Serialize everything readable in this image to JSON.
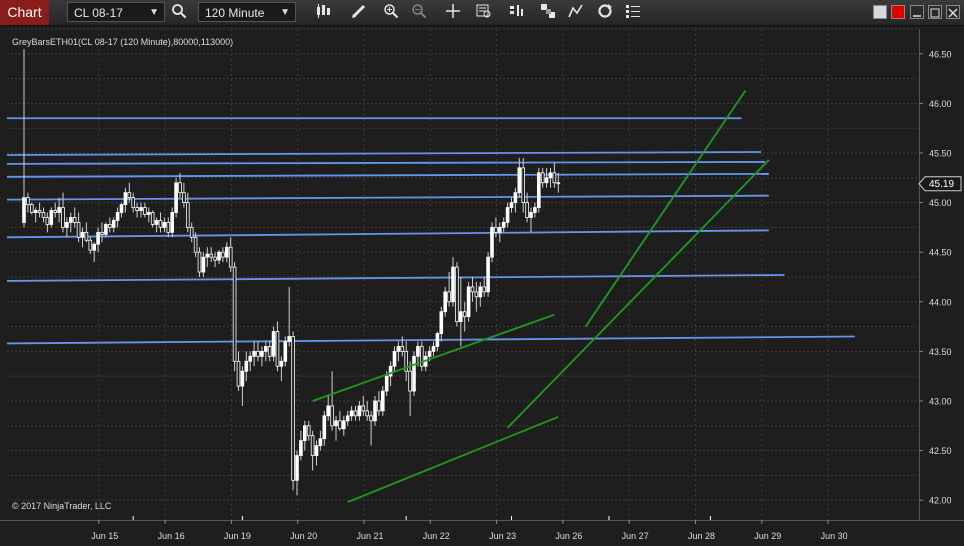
{
  "toolbar": {
    "chart_tab": "Chart",
    "instrument": "CL 08-17",
    "interval": "120 Minute",
    "icons": [
      "search-icon",
      "bar-type-icon",
      "pencil-icon",
      "zoom-in-icon",
      "zoom-out-icon",
      "crosshair-icon",
      "data-box-icon",
      "strategies-icon",
      "indicators-icon",
      "drawing-tools-icon",
      "reload-icon",
      "properties-icon"
    ]
  },
  "chart": {
    "title": "GreyBarsETH01(CL 08-17 (120 Minute),80000,113000)",
    "copyright": "© 2017 NinjaTrader, LLC",
    "last_price": "45.19",
    "colors": {
      "background": "#1e1e1e",
      "grid": "#3c3c3c",
      "candle": "#ffffff",
      "wick": "#cfcfcf",
      "hline": "#6495ed",
      "trendline": "#1e9a1e",
      "marker": "#ffffff"
    }
  },
  "chart_data": {
    "type": "candlestick",
    "title": "GreyBarsETH01(CL 08-17 (120 Minute),80000,113000)",
    "ylim": [
      41.8,
      46.75
    ],
    "yticks": [
      "46.50",
      "46.00",
      "45.50",
      "45.00",
      "44.50",
      "44.00",
      "43.50",
      "43.00",
      "42.50",
      "42.00"
    ],
    "ytick_values": [
      46.5,
      46.0,
      45.5,
      45.0,
      44.5,
      44.0,
      43.5,
      43.0,
      42.5,
      42.0
    ],
    "xticks": [
      "Jun 15",
      "Jun 16",
      "Jun 19",
      "Jun 20",
      "Jun 21",
      "Jun 22",
      "Jun 23",
      "Jun 26",
      "Jun 27",
      "Jun 28",
      "Jun 29",
      "Jun 30"
    ],
    "xtick_index": [
      12,
      29,
      46,
      63,
      80,
      97,
      114,
      131,
      148,
      165,
      182,
      199
    ],
    "candles": [
      [
        44.8,
        46.55,
        44.75,
        45.05
      ],
      [
        45.05,
        45.1,
        44.9,
        44.98
      ],
      [
        44.98,
        45.0,
        44.88,
        44.9
      ],
      [
        44.9,
        44.95,
        44.8,
        44.92
      ],
      [
        44.92,
        45.0,
        44.85,
        44.9
      ],
      [
        44.9,
        44.95,
        44.8,
        44.85
      ],
      [
        44.85,
        44.9,
        44.7,
        44.78
      ],
      [
        44.78,
        44.95,
        44.75,
        44.92
      ],
      [
        44.92,
        45.0,
        44.85,
        44.9
      ],
      [
        44.9,
        45.05,
        44.8,
        44.95
      ],
      [
        44.95,
        45.1,
        44.7,
        44.75
      ],
      [
        44.75,
        44.85,
        44.65,
        44.8
      ],
      [
        44.8,
        44.9,
        44.7,
        44.85
      ],
      [
        44.85,
        44.95,
        44.75,
        44.8
      ],
      [
        44.8,
        44.9,
        44.6,
        44.65
      ],
      [
        44.65,
        44.75,
        44.55,
        44.7
      ],
      [
        44.7,
        44.8,
        44.6,
        44.62
      ],
      [
        44.62,
        44.65,
        44.48,
        44.52
      ],
      [
        44.52,
        44.6,
        44.4,
        44.58
      ],
      [
        44.58,
        44.75,
        44.5,
        44.7
      ],
      [
        44.7,
        44.8,
        44.6,
        44.68
      ],
      [
        44.68,
        44.8,
        44.65,
        44.78
      ],
      [
        44.78,
        44.85,
        44.7,
        44.75
      ],
      [
        44.75,
        44.85,
        44.7,
        44.82
      ],
      [
        44.82,
        44.95,
        44.75,
        44.9
      ],
      [
        44.9,
        45.0,
        44.85,
        44.98
      ],
      [
        44.98,
        45.15,
        44.9,
        45.1
      ],
      [
        45.1,
        45.2,
        45.0,
        45.05
      ],
      [
        45.05,
        45.1,
        44.9,
        44.95
      ],
      [
        44.95,
        45.0,
        44.85,
        44.92
      ],
      [
        44.92,
        45.0,
        44.85,
        44.95
      ],
      [
        44.95,
        45.0,
        44.85,
        44.88
      ],
      [
        44.88,
        44.95,
        44.8,
        44.9
      ],
      [
        44.9,
        44.92,
        44.75,
        44.78
      ],
      [
        44.78,
        44.85,
        44.7,
        44.82
      ],
      [
        44.82,
        44.9,
        44.7,
        44.75
      ],
      [
        44.75,
        44.85,
        44.7,
        44.8
      ],
      [
        44.8,
        44.85,
        44.65,
        44.7
      ],
      [
        44.7,
        44.95,
        44.65,
        44.9
      ],
      [
        44.9,
        45.25,
        44.85,
        45.2
      ],
      [
        45.2,
        45.3,
        45.05,
        45.1
      ],
      [
        45.1,
        45.2,
        44.95,
        45.0
      ],
      [
        45.0,
        45.1,
        44.7,
        44.75
      ],
      [
        44.75,
        44.8,
        44.6,
        44.65
      ],
      [
        44.65,
        44.7,
        44.45,
        44.5
      ],
      [
        44.5,
        44.55,
        44.25,
        44.3
      ],
      [
        44.3,
        44.5,
        44.25,
        44.45
      ],
      [
        44.45,
        44.55,
        44.35,
        44.48
      ],
      [
        44.48,
        44.55,
        44.4,
        44.45
      ],
      [
        44.45,
        44.5,
        44.35,
        44.42
      ],
      [
        44.42,
        44.52,
        44.38,
        44.5
      ],
      [
        44.5,
        44.55,
        44.4,
        44.45
      ],
      [
        44.45,
        44.6,
        44.4,
        44.55
      ],
      [
        44.55,
        44.65,
        44.3,
        44.35
      ],
      [
        44.35,
        44.4,
        43.3,
        43.4
      ],
      [
        43.4,
        43.5,
        43.1,
        43.15
      ],
      [
        43.15,
        43.35,
        42.95,
        43.3
      ],
      [
        43.3,
        43.5,
        43.2,
        43.4
      ],
      [
        43.4,
        43.5,
        43.3,
        43.45
      ],
      [
        43.45,
        43.6,
        43.35,
        43.5
      ],
      [
        43.5,
        43.6,
        43.4,
        43.45
      ],
      [
        43.45,
        43.55,
        43.35,
        43.5
      ],
      [
        43.5,
        43.6,
        43.4,
        43.55
      ],
      [
        43.55,
        43.6,
        43.4,
        43.45
      ],
      [
        43.45,
        43.75,
        43.4,
        43.7
      ],
      [
        43.7,
        43.8,
        43.3,
        43.35
      ],
      [
        43.35,
        43.45,
        43.2,
        43.4
      ],
      [
        43.4,
        43.65,
        43.35,
        43.6
      ],
      [
        43.6,
        44.15,
        43.55,
        43.65
      ],
      [
        43.65,
        43.7,
        42.1,
        42.2
      ],
      [
        42.2,
        42.5,
        42.05,
        42.45
      ],
      [
        42.45,
        42.7,
        42.4,
        42.6
      ],
      [
        42.6,
        42.8,
        42.5,
        42.75
      ],
      [
        42.75,
        42.8,
        42.6,
        42.65
      ],
      [
        42.65,
        42.7,
        42.3,
        42.45
      ],
      [
        42.45,
        42.6,
        42.35,
        42.55
      ],
      [
        42.55,
        42.7,
        42.5,
        42.62
      ],
      [
        42.62,
        42.9,
        42.55,
        42.85
      ],
      [
        42.85,
        43.05,
        42.8,
        42.95
      ],
      [
        42.95,
        43.3,
        42.7,
        42.75
      ],
      [
        42.75,
        42.85,
        42.6,
        42.8
      ],
      [
        42.8,
        42.9,
        42.7,
        42.72
      ],
      [
        42.72,
        42.85,
        42.65,
        42.8
      ],
      [
        42.8,
        42.9,
        42.75,
        42.85
      ],
      [
        42.85,
        42.95,
        42.8,
        42.9
      ],
      [
        42.9,
        42.95,
        42.8,
        42.85
      ],
      [
        42.85,
        43.0,
        42.8,
        42.95
      ],
      [
        42.95,
        43.05,
        42.85,
        42.9
      ],
      [
        42.9,
        43.0,
        42.8,
        42.85
      ],
      [
        42.85,
        42.9,
        42.55,
        42.8
      ],
      [
        42.8,
        43.05,
        42.75,
        43.0
      ],
      [
        43.0,
        43.1,
        42.85,
        42.9
      ],
      [
        42.9,
        43.15,
        42.85,
        43.1
      ],
      [
        43.1,
        43.3,
        43.05,
        43.25
      ],
      [
        43.25,
        43.4,
        43.15,
        43.35
      ],
      [
        43.35,
        43.55,
        43.3,
        43.5
      ],
      [
        43.5,
        43.6,
        43.4,
        43.55
      ],
      [
        43.55,
        43.65,
        43.45,
        43.5
      ],
      [
        43.5,
        43.6,
        43.2,
        43.3
      ],
      [
        43.3,
        43.4,
        42.85,
        43.1
      ],
      [
        43.1,
        43.5,
        43.05,
        43.45
      ],
      [
        43.45,
        43.6,
        43.35,
        43.55
      ],
      [
        43.55,
        43.6,
        43.3,
        43.35
      ],
      [
        43.35,
        43.5,
        43.3,
        43.45
      ],
      [
        43.45,
        43.55,
        43.4,
        43.5
      ],
      [
        43.5,
        43.6,
        43.45,
        43.55
      ],
      [
        43.55,
        43.7,
        43.5,
        43.68
      ],
      [
        43.68,
        43.95,
        43.6,
        43.9
      ],
      [
        43.9,
        44.15,
        43.85,
        44.1
      ],
      [
        44.1,
        44.3,
        43.95,
        44.0
      ],
      [
        44.0,
        44.45,
        43.95,
        44.35
      ],
      [
        44.35,
        44.4,
        43.75,
        43.8
      ],
      [
        43.8,
        44.25,
        43.55,
        43.9
      ],
      [
        43.9,
        44.0,
        43.7,
        43.85
      ],
      [
        43.85,
        44.2,
        43.8,
        44.15
      ],
      [
        44.15,
        44.25,
        44.0,
        44.1
      ],
      [
        44.1,
        44.2,
        43.9,
        44.05
      ],
      [
        44.05,
        44.2,
        43.95,
        44.15
      ],
      [
        44.15,
        44.25,
        44.05,
        44.1
      ],
      [
        44.1,
        44.5,
        44.05,
        44.45
      ],
      [
        44.45,
        44.8,
        44.4,
        44.75
      ],
      [
        44.75,
        44.85,
        44.65,
        44.7
      ],
      [
        44.7,
        44.8,
        44.6,
        44.75
      ],
      [
        44.75,
        44.85,
        44.7,
        44.8
      ],
      [
        44.8,
        45.0,
        44.75,
        44.95
      ],
      [
        44.95,
        45.05,
        44.9,
        45.0
      ],
      [
        45.0,
        45.15,
        44.9,
        45.1
      ],
      [
        45.1,
        45.45,
        45.05,
        45.35
      ],
      [
        45.35,
        45.45,
        44.9,
        45.0
      ],
      [
        45.0,
        45.1,
        44.8,
        44.85
      ],
      [
        44.85,
        44.95,
        44.7,
        44.9
      ],
      [
        44.9,
        45.0,
        44.85,
        44.95
      ],
      [
        44.95,
        45.35,
        44.9,
        45.3
      ],
      [
        45.3,
        45.35,
        45.15,
        45.2
      ],
      [
        45.2,
        45.35,
        45.15,
        45.25
      ],
      [
        45.25,
        45.35,
        45.15,
        45.3
      ],
      [
        45.3,
        45.4,
        45.15,
        45.2
      ],
      [
        45.2,
        45.3,
        45.1,
        45.19
      ]
    ],
    "horizontal_lines": [
      {
        "y1": 45.85,
        "y2": 45.85,
        "x1": 0,
        "x2": 184
      },
      {
        "y1": 45.48,
        "y2": 45.51,
        "x1": 0,
        "x2": 189
      },
      {
        "y1": 45.39,
        "y2": 45.41,
        "x1": 0,
        "x2": 190
      },
      {
        "y1": 45.26,
        "y2": 45.29,
        "x1": 0,
        "x2": 191
      },
      {
        "y1": 45.03,
        "y2": 45.07,
        "x1": 0,
        "x2": 191
      },
      {
        "y1": 44.65,
        "y2": 44.72,
        "x1": 0,
        "x2": 191
      },
      {
        "y1": 44.21,
        "y2": 44.27,
        "x1": 0,
        "x2": 195
      },
      {
        "y1": 43.58,
        "y2": 43.65,
        "x1": 0,
        "x2": 213
      }
    ],
    "trendlines": [
      {
        "x1": 74,
        "y1": 43.0,
        "x2": 136,
        "y2": 43.87
      },
      {
        "x1": 83,
        "y1": 41.98,
        "x2": 137,
        "y2": 42.84
      },
      {
        "x1": 124,
        "y1": 42.73,
        "x2": 191,
        "y2": 45.43
      },
      {
        "x1": 144,
        "y1": 43.75,
        "x2": 185,
        "y2": 46.13
      }
    ],
    "markers_x": [
      28,
      56,
      98,
      125,
      150,
      176
    ]
  }
}
